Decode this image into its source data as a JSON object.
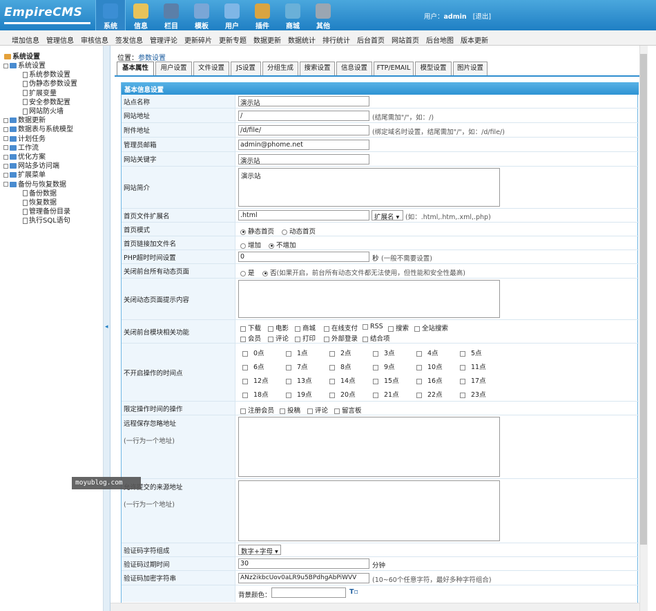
{
  "brand": {
    "logo_text": "EmpireCMS"
  },
  "topnav": [
    {
      "label": "系统",
      "icon": "globe-icon",
      "color": "#3b8ed4",
      "active": true
    },
    {
      "label": "信息",
      "icon": "notepad-icon",
      "color": "#e8c35a"
    },
    {
      "label": "栏目",
      "icon": "folder-icon",
      "color": "#5b7fa8"
    },
    {
      "label": "模板",
      "icon": "template-icon",
      "color": "#7aa6d6"
    },
    {
      "label": "用户",
      "icon": "user-icon",
      "color": "#7fb6e6"
    },
    {
      "label": "插件",
      "icon": "tools-icon",
      "color": "#d9a441"
    },
    {
      "label": "商城",
      "icon": "shop-icon",
      "color": "#6ab0d8"
    },
    {
      "label": "其他",
      "icon": "gear-icon",
      "color": "#9aa6b2"
    }
  ],
  "user": {
    "prefix": "用户：",
    "name": "admin",
    "logout": "[退出]"
  },
  "subnav": [
    "增加信息",
    "管理信息",
    "审核信息",
    "签发信息",
    "管理评论",
    "更新碎片",
    "更新专题",
    "数据更新",
    "数据统计",
    "排行统计",
    "后台首页",
    "网站首页",
    "后台地图",
    "版本更新"
  ],
  "sidebar": {
    "root": "系统设置",
    "items": [
      {
        "label": "系统设置",
        "level": 1,
        "kind": "folder-open"
      },
      {
        "label": "系统参数设置",
        "level": 2,
        "kind": "page"
      },
      {
        "label": "伪静态参数设置",
        "level": 2,
        "kind": "page"
      },
      {
        "label": "扩展变量",
        "level": 2,
        "kind": "page"
      },
      {
        "label": "安全参数配置",
        "level": 2,
        "kind": "page"
      },
      {
        "label": "网站防火墙",
        "level": 2,
        "kind": "page"
      },
      {
        "label": "数据更新",
        "level": 1,
        "kind": "folder"
      },
      {
        "label": "数据表与系统模型",
        "level": 1,
        "kind": "folder"
      },
      {
        "label": "计划任务",
        "level": 1,
        "kind": "folder"
      },
      {
        "label": "工作流",
        "level": 1,
        "kind": "folder"
      },
      {
        "label": "优化方案",
        "level": 1,
        "kind": "folder"
      },
      {
        "label": "网站多访问端",
        "level": 1,
        "kind": "folder"
      },
      {
        "label": "扩展菜单",
        "level": 1,
        "kind": "folder"
      },
      {
        "label": "备份与恢复数据",
        "level": 1,
        "kind": "folder-open"
      },
      {
        "label": "备份数据",
        "level": 2,
        "kind": "page"
      },
      {
        "label": "恢复数据",
        "level": 2,
        "kind": "page"
      },
      {
        "label": "管理备份目录",
        "level": 2,
        "kind": "page"
      },
      {
        "label": "执行SQL语句",
        "level": 2,
        "kind": "page"
      }
    ]
  },
  "crumb": {
    "prefix": "位置：",
    "link": "参数设置"
  },
  "tabs": [
    "基本属性",
    "用户设置",
    "文件设置",
    "JS设置",
    "分组生成",
    "搜索设置",
    "信息设置",
    "FTP/EMAIL",
    "模型设置",
    "图片设置"
  ],
  "form": {
    "section": "基本信息设置",
    "site_name": {
      "label": "站点名称",
      "value": "演示站"
    },
    "site_url": {
      "label": "网站地址",
      "value": "/",
      "hint": "(结尾需加\"/\"，如：/)"
    },
    "file_url": {
      "label": "附件地址",
      "value": "/d/file/",
      "hint": "(绑定域名时设置，结尾需加\"/\"，如：/d/file/)"
    },
    "admin_email": {
      "label": "管理员邮箱",
      "value": "admin@phome.net"
    },
    "keywords": {
      "label": "网站关键字",
      "value": "演示站"
    },
    "intro": {
      "label": "网站简介",
      "value": "演示站"
    },
    "index_ext": {
      "label": "首页文件扩展名",
      "value": ".html",
      "select": "扩展名",
      "hint": "(如：.html,.htm,.xml,.php)"
    },
    "index_mode": {
      "label": "首页模式",
      "opt1": "静态首页",
      "opt2": "动态首页"
    },
    "index_link": {
      "label": "首页链接加文件名",
      "opt1": "增加",
      "opt2": "不增加"
    },
    "php_timeout": {
      "label": "PHP超时时间设置",
      "value": "0",
      "unit": "秒",
      "hint": "(一般不需要设置)"
    },
    "close_dynamic": {
      "label": "关闭前台所有动态页面",
      "opt1": "是",
      "opt2": "否",
      "hint": "(如果开启，前台所有动态文件都无法使用，但性能和安全性最高)"
    },
    "close_msg": {
      "label": "关闭动态页面提示内容"
    },
    "close_modules": {
      "label": "关闭前台模块相关功能",
      "row1": [
        "下载",
        "电影",
        "商城",
        "在线支付",
        "RSS",
        "搜索",
        "全站搜索"
      ],
      "row2": [
        "会员",
        "评论",
        "打印",
        "外部登录",
        "结合项"
      ]
    },
    "closed_hours": {
      "label": "不开启操作的时间点",
      "hours": [
        "0点",
        "1点",
        "2点",
        "3点",
        "4点",
        "5点",
        "6点",
        "7点",
        "8点",
        "9点",
        "10点",
        "11点",
        "12点",
        "13点",
        "14点",
        "15点",
        "16点",
        "17点",
        "18点",
        "19点",
        "20点",
        "21点",
        "22点",
        "23点"
      ]
    },
    "limit_ops": {
      "label": "限定操作时间的操作",
      "opts": [
        "注册会员",
        "投稿",
        "评论",
        "留言板"
      ]
    },
    "remote_ignore": {
      "label": "远程保存忽略地址",
      "sub": "(一行为一个地址)"
    },
    "allow_source": {
      "label": "允许提交的来源地址",
      "sub": "(一行为一个地址)"
    },
    "captcha_chars": {
      "label": "验证码字符组成",
      "value": "数字+字母"
    },
    "captcha_expire": {
      "label": "验证码过期时间",
      "value": "30",
      "unit": "分钟"
    },
    "captcha_key": {
      "label": "验证码加密字符串",
      "value": "ANz2ikbcUov0aLR9u5BPdhgAbPiWVV",
      "hint": "(10~60个任意字符，最好多种字符组合)"
    },
    "bg_color": {
      "label": "背景颜色："
    }
  },
  "watermark": "moyublog.com"
}
